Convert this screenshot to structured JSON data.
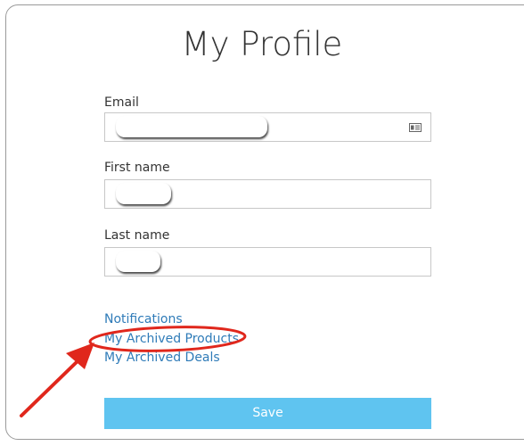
{
  "page": {
    "title": "My Profile"
  },
  "form": {
    "email_label": "Email",
    "email_value": "",
    "first_name_label": "First name",
    "first_name_value": "",
    "last_name_label": "Last name",
    "last_name_value": ""
  },
  "links": {
    "notifications": "Notifications",
    "archived_products": "My Archived Products",
    "archived_deals": "My Archived Deals"
  },
  "actions": {
    "save_label": "Save"
  },
  "colors": {
    "link": "#2f7bb8",
    "button": "#5fc4f0",
    "annotation": "#e0271c"
  },
  "icons": {
    "email_field": "contact-card-icon"
  }
}
